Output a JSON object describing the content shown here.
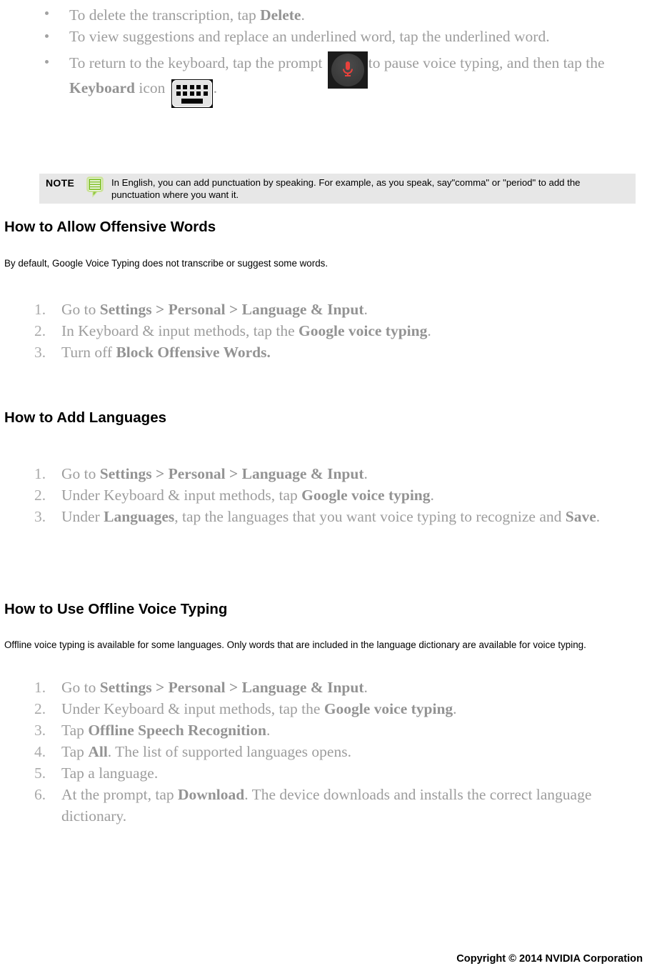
{
  "bullets": [
    {
      "id": "delete-transcription",
      "segments": [
        {
          "t": "To delete the transcription, tap ",
          "b": false
        },
        {
          "t": "Delete",
          "b": true
        },
        {
          "t": ".",
          "b": false
        }
      ]
    },
    {
      "id": "view-suggestions",
      "segments": [
        {
          "t": "To view suggestions and replace an underlined word, tap the underlined word.",
          "b": false
        }
      ]
    },
    {
      "id": "return-to-keyboard",
      "segments": [
        {
          "t": "To return to the keyboard, tap the prompt ",
          "b": false
        },
        {
          "icon": "microphone-icon"
        },
        {
          "t": "to pause voice typing, and then tap the ",
          "b": false
        },
        {
          "t": "Keyboard",
          "b": true
        },
        {
          "t": " icon ",
          "b": false
        },
        {
          "icon": "keyboard-icon"
        },
        {
          "t": ".",
          "b": false
        }
      ]
    }
  ],
  "note": {
    "label": "NOTE",
    "icon": "note-bubble-icon",
    "text": "In English, you can add punctuation by speaking. For example, as you speak, say\"comma\" or \"period\" to add the punctuation where you want it."
  },
  "sections": [
    {
      "id": "offensive-words",
      "title": "How to Allow Offensive Words",
      "intro": "By default, Google Voice Typing does not transcribe or suggest some words.",
      "steps": [
        {
          "num": "1.",
          "segments": [
            {
              "t": "Go to ",
              "b": false
            },
            {
              "t": "Settings > Personal > Language & Input",
              "b": true
            },
            {
              "t": ".",
              "b": false
            }
          ]
        },
        {
          "num": "2.",
          "segments": [
            {
              "t": "In Keyboard & input methods, tap the ",
              "b": false
            },
            {
              "t": "Google voice typing",
              "b": true
            },
            {
              "t": ".",
              "b": false
            }
          ]
        },
        {
          "num": "3.",
          "segments": [
            {
              "t": "Turn off ",
              "b": false
            },
            {
              "t": "Block Offensive Words.",
              "b": true
            }
          ]
        }
      ]
    },
    {
      "id": "add-languages",
      "title": "How to Add Languages",
      "intro": "",
      "steps": [
        {
          "num": "1.",
          "segments": [
            {
              "t": "Go to ",
              "b": false
            },
            {
              "t": "Settings > Personal > Language & Input",
              "b": true
            },
            {
              "t": ".",
              "b": false
            }
          ]
        },
        {
          "num": "2.",
          "segments": [
            {
              "t": "Under Keyboard & input methods, tap ",
              "b": false
            },
            {
              "t": "Google voice typing",
              "b": true
            },
            {
              "t": ".",
              "b": false
            }
          ]
        },
        {
          "num": "3.",
          "segments": [
            {
              "t": "Under ",
              "b": false
            },
            {
              "t": "Languages",
              "b": true
            },
            {
              "t": ", tap the languages that you want voice typing to recognize and ",
              "b": false
            },
            {
              "t": "Save",
              "b": true
            },
            {
              "t": ".",
              "b": false
            }
          ]
        }
      ]
    },
    {
      "id": "offline-voice-typing",
      "title": "How to Use Offline Voice Typing",
      "intro": "Offline voice typing is available for some languages. Only words that are included in the language dictionary are available for voice typing.",
      "steps": [
        {
          "num": "1.",
          "segments": [
            {
              "t": "Go to ",
              "b": false
            },
            {
              "t": "Settings > Personal > Language & Input",
              "b": true
            },
            {
              "t": ".",
              "b": false
            }
          ]
        },
        {
          "num": "2.",
          "segments": [
            {
              "t": "Under Keyboard & input methods, tap the ",
              "b": false
            },
            {
              "t": "Google voice typing",
              "b": true
            },
            {
              "t": ".",
              "b": false
            }
          ]
        },
        {
          "num": "3.",
          "segments": [
            {
              "t": "Tap ",
              "b": false
            },
            {
              "t": "Offline Speech Recognition",
              "b": true
            },
            {
              "t": ".",
              "b": false
            }
          ]
        },
        {
          "num": "4.",
          "segments": [
            {
              "t": "Tap ",
              "b": false
            },
            {
              "t": "All",
              "b": true
            },
            {
              "t": ". The list of supported languages opens.",
              "b": false
            }
          ]
        },
        {
          "num": "5.",
          "segments": [
            {
              "t": "Tap a language.",
              "b": false
            }
          ]
        },
        {
          "num": "6.",
          "segments": [
            {
              "t": "At the prompt, tap ",
              "b": false
            },
            {
              "t": "Download",
              "b": true
            },
            {
              "t": ". The device downloads and installs the correct language dictionary.",
              "b": false
            }
          ]
        }
      ]
    }
  ],
  "footer": {
    "copyright": "Copyright © 2014 NVIDIA Corporation"
  },
  "colors": {
    "list_text": "#9d9d9d",
    "list_bold": "#939393",
    "heading": "#000000",
    "note_background": "#e7e7e7",
    "note_icon_green": "#8dc63f",
    "mic_red": "#e8413c"
  }
}
